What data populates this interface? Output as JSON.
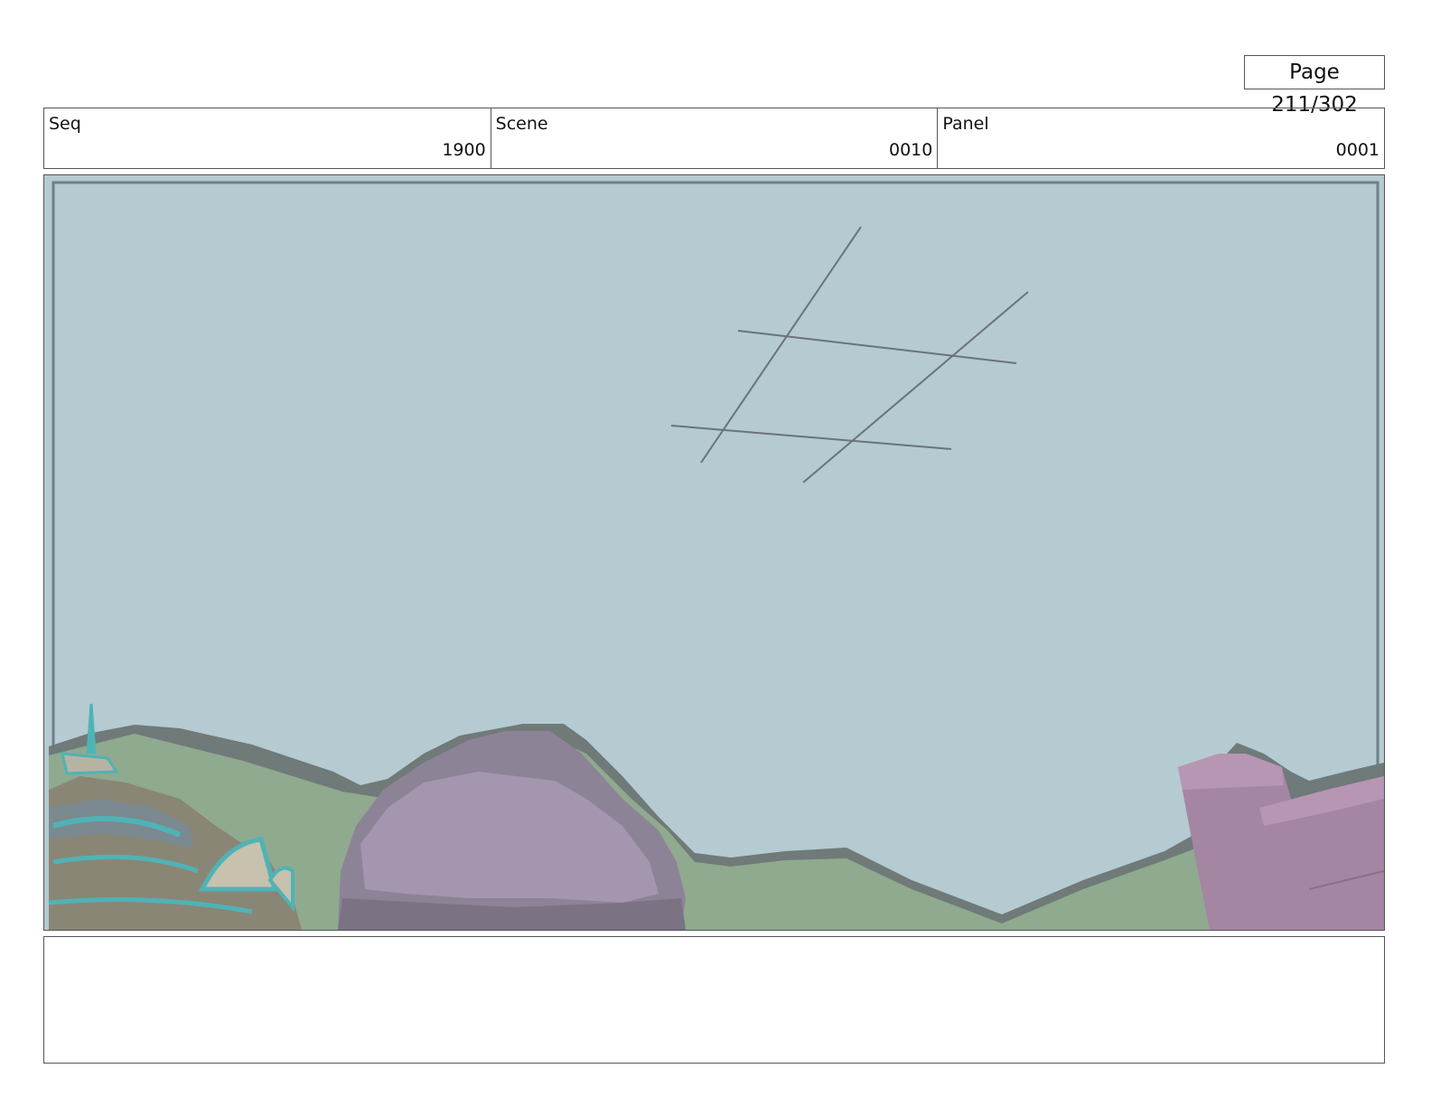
{
  "page": {
    "label": "Page 211/302"
  },
  "info": {
    "seq_label": "Seq",
    "seq_value": "1900",
    "scene_label": "Scene",
    "scene_value": "0010",
    "panel_label": "Panel",
    "panel_value": "0001"
  },
  "notes": {
    "text": ""
  },
  "colors": {
    "sky": "#b5cad1",
    "hills": "#8faa8e",
    "rock": "#9a8ea6",
    "pillar": "#a486a2",
    "building_accent": "#4fb3b6"
  }
}
